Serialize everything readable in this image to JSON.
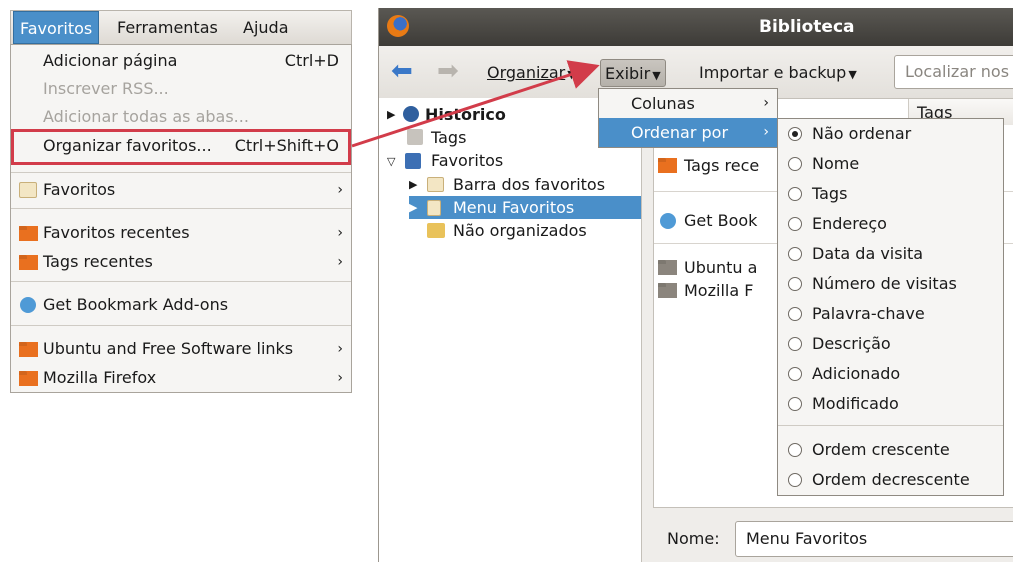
{
  "left_menu": {
    "menubar": [
      "Favoritos",
      "Ferramentas",
      "Ajuda"
    ],
    "items": [
      {
        "label": "Adicionar página",
        "shortcut": "Ctrl+D"
      },
      {
        "label": "Inscrever RSS...",
        "disabled": true
      },
      {
        "label": "Adicionar todas as abas...",
        "disabled": true
      },
      {
        "label": "Organizar favoritos...",
        "shortcut": "Ctrl+Shift+O"
      },
      {
        "label": "Favoritos",
        "submenu": true
      },
      {
        "label": "Favoritos recentes",
        "submenu": true
      },
      {
        "label": "Tags recentes",
        "submenu": true
      },
      {
        "label": "Get Bookmark Add-ons"
      },
      {
        "label": "Ubuntu and Free Software links",
        "submenu": true
      },
      {
        "label": "Mozilla Firefox",
        "submenu": true
      }
    ],
    "submenu_arrow": "›"
  },
  "library": {
    "title": "Biblioteca",
    "toolbar": {
      "organizar": "Organizar",
      "exibir": "Exibir",
      "importar": "Importar e backup",
      "search_placeholder": "Localizar nos"
    },
    "tree": [
      "Histórico",
      "Tags",
      "Favoritos",
      "Barra dos favoritos",
      "Menu Favoritos",
      "Não organizados"
    ],
    "content": {
      "column_header": "Tags",
      "rows": [
        "Tags rece",
        "Get Book",
        "Ubuntu a",
        "Mozilla F"
      ]
    },
    "name_label": "Nome:",
    "name_value": "Menu Favoritos"
  },
  "exibir_menu": {
    "items": [
      {
        "label": "Colunas"
      },
      {
        "label": "Ordenar por",
        "selected": true
      }
    ]
  },
  "ordenar_menu": {
    "items": [
      {
        "label": "Não ordenar",
        "checked": true
      },
      {
        "label": "Nome"
      },
      {
        "label": "Tags"
      },
      {
        "label": "Endereço"
      },
      {
        "label": "Data da visita"
      },
      {
        "label": "Número de visitas"
      },
      {
        "label": "Palavra-chave"
      },
      {
        "label": "Descrição"
      },
      {
        "label": "Adicionado"
      },
      {
        "label": "Modificado"
      },
      {
        "label": "Ordem crescente"
      },
      {
        "label": "Ordem decrescente"
      }
    ]
  },
  "colors": {
    "highlight": "#4a8fc9",
    "callout": "#d23c4a",
    "titlebar": "#3d3b37"
  }
}
